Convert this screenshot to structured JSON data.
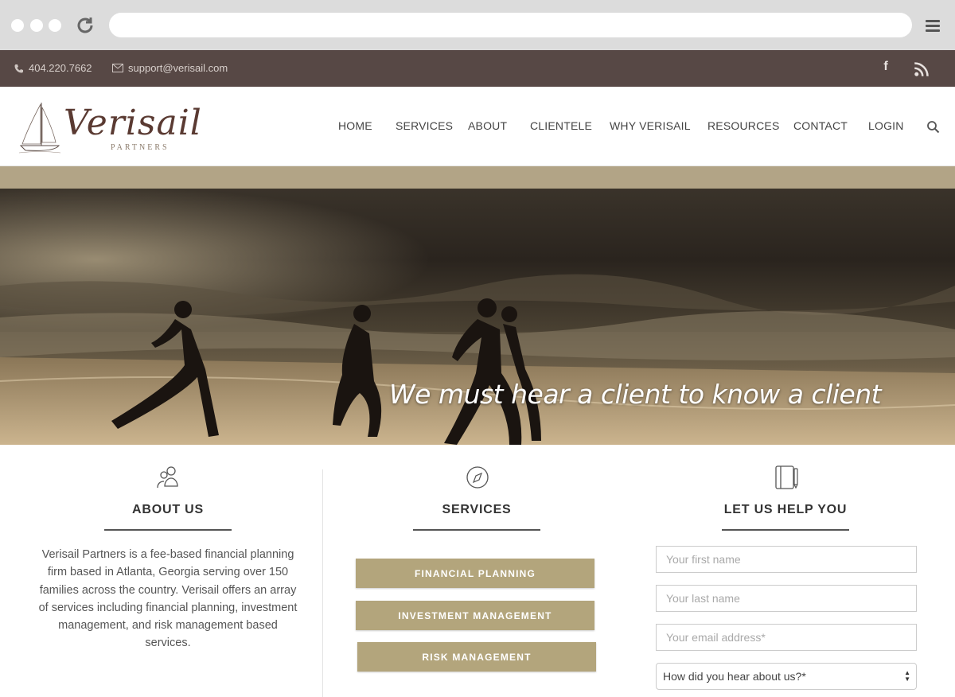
{
  "browser": {
    "icons": [
      "window-dot",
      "reload-icon",
      "menu-icon"
    ]
  },
  "topbar": {
    "phone": "404.220.7662",
    "email": "support@verisail.com",
    "social": [
      "facebook-icon",
      "rss-icon"
    ]
  },
  "header": {
    "logo_word": "Verisail",
    "logo_sub": "PARTNERS",
    "nav": [
      "HOME",
      "SERVICES",
      "ABOUT",
      "CLIENTELE",
      "WHY VERISAIL",
      "RESOURCES",
      "CONTACT",
      "LOGIN"
    ]
  },
  "hero": {
    "tagline": "We must hear a client to know a client"
  },
  "about": {
    "title": "ABOUT US",
    "text": "Verisail Partners is a fee-based financial planning firm based in Atlanta, Georgia serving over 150 families across the country. Verisail offers an array of services including financial planning, investment management, and risk management based services."
  },
  "services": {
    "title": "SERVICES",
    "buttons": [
      "FINANCIAL PLANNING",
      "INVESTMENT MANAGEMENT",
      "RISK MANAGEMENT"
    ]
  },
  "help": {
    "title": "LET US HELP YOU",
    "first_name_placeholder": "Your first name",
    "last_name_placeholder": "Your last name",
    "email_placeholder": "Your email address*",
    "source_select": "How did you hear about us?*"
  },
  "colors": {
    "topbar": "#574845",
    "button": "#b3a57c",
    "logo": "#5a3a32"
  }
}
